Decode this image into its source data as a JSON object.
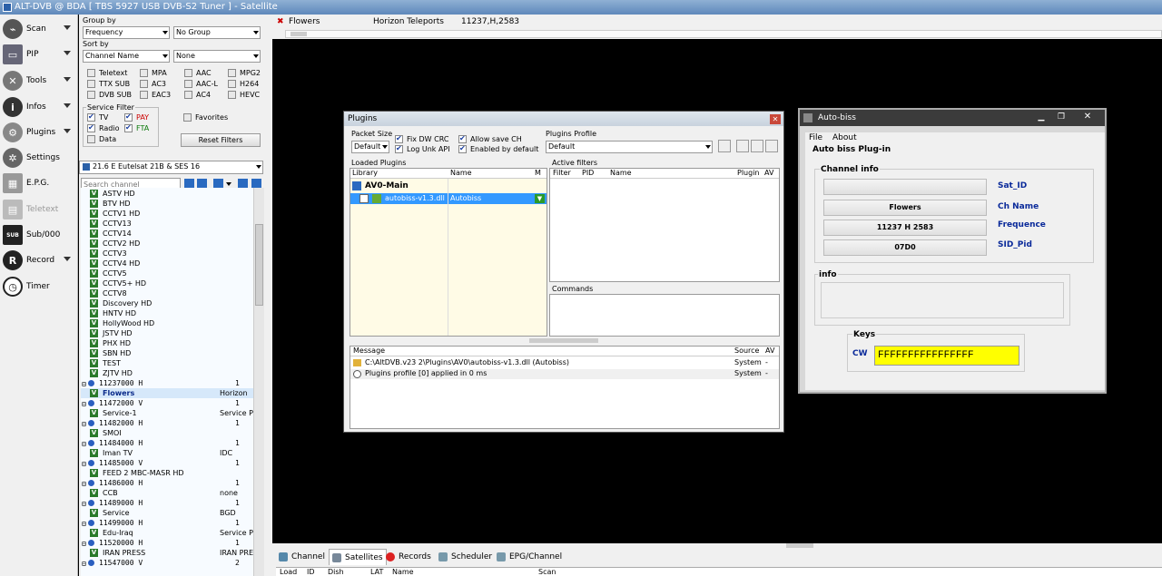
{
  "window_title": "ALT-DVB @ BDA [ TBS 5927 USB DVB-S2 Tuner ] - Satellite",
  "nav": [
    {
      "label": "Scan",
      "icon": "satellite-dish-icon",
      "arrow": true
    },
    {
      "label": "PIP",
      "icon": "pip-icon",
      "arrow": true
    },
    {
      "label": "Tools",
      "icon": "tools-icon",
      "arrow": true
    },
    {
      "label": "Infos",
      "icon": "info-icon",
      "arrow": true
    },
    {
      "label": "Plugins",
      "icon": "plugins-icon",
      "arrow": true
    },
    {
      "label": "Settings",
      "icon": "gear-icon",
      "arrow": false
    },
    {
      "label": "E.P.G.",
      "icon": "epg-icon",
      "arrow": false
    },
    {
      "label": "Teletext",
      "icon": "teletext-icon",
      "arrow": false
    },
    {
      "label": "Sub/000",
      "icon": "subtitle-icon",
      "arrow": false
    },
    {
      "label": "Record",
      "icon": "record-icon",
      "arrow": true
    },
    {
      "label": "Timer",
      "icon": "timer-icon",
      "arrow": false
    }
  ],
  "panel": {
    "group_by_label": "Group by",
    "group_by_value": "Frequency",
    "group_value": "No Group",
    "sort_by_label": "Sort by",
    "sort_by_value": "Channel Name",
    "sort_value": "None",
    "filters": [
      [
        "Teletext",
        "MPA",
        "AAC",
        "MPG2"
      ],
      [
        "TTX SUB",
        "AC3",
        "AAC-L",
        "H264"
      ],
      [
        "DVB SUB",
        "EAC3",
        "AC4",
        "HEVC"
      ]
    ],
    "service_filter_label": "Service Filter",
    "service_filters": [
      "TV",
      "PAY",
      "Radio",
      "FTA",
      "Data"
    ],
    "favorites_label": "Favorites",
    "reset_label": "Reset Filters",
    "satellite": "21.6 E Eutelsat 21B & SES 16",
    "search_placeholder": "Search channel"
  },
  "channels": [
    {
      "t": "ch",
      "name": "ASTV HD"
    },
    {
      "t": "ch",
      "name": "BTV HD"
    },
    {
      "t": "ch",
      "name": "CCTV1 HD"
    },
    {
      "t": "ch",
      "name": "CCTV13"
    },
    {
      "t": "ch",
      "name": "CCTV14"
    },
    {
      "t": "ch",
      "name": "CCTV2 HD"
    },
    {
      "t": "ch",
      "name": "CCTV3"
    },
    {
      "t": "ch",
      "name": "CCTV4 HD"
    },
    {
      "t": "ch",
      "name": "CCTV5"
    },
    {
      "t": "ch",
      "name": "CCTV5+ HD"
    },
    {
      "t": "ch",
      "name": "CCTV8"
    },
    {
      "t": "ch",
      "name": "Discovery HD"
    },
    {
      "t": "ch",
      "name": "HNTV HD"
    },
    {
      "t": "ch",
      "name": "HollyWood HD"
    },
    {
      "t": "ch",
      "name": "JSTV HD"
    },
    {
      "t": "ch",
      "name": "PHX HD"
    },
    {
      "t": "ch",
      "name": "SBN HD"
    },
    {
      "t": "ch",
      "name": "TEST"
    },
    {
      "t": "ch",
      "name": "ZJTV HD"
    },
    {
      "t": "grp",
      "name": "11237000 H",
      "c2": "1"
    },
    {
      "t": "ch",
      "name": "Flowers",
      "c2": "Horizon",
      "hl": true
    },
    {
      "t": "grp",
      "name": "11472000 V",
      "c2": "1"
    },
    {
      "t": "ch",
      "name": "Service-1",
      "c2": "Service P"
    },
    {
      "t": "grp",
      "name": "11482000 H",
      "c2": "1"
    },
    {
      "t": "ch",
      "name": "SMOI"
    },
    {
      "t": "grp",
      "name": "11484000 H",
      "c2": "1"
    },
    {
      "t": "ch",
      "name": "Iman TV",
      "c2": "IDC"
    },
    {
      "t": "grp",
      "name": "11485000 V",
      "c2": "1"
    },
    {
      "t": "ch",
      "name": "FEED 2 MBC-MASR HD"
    },
    {
      "t": "grp",
      "name": "11486000 H",
      "c2": "1"
    },
    {
      "t": "ch",
      "name": "CCB",
      "c2": "none"
    },
    {
      "t": "grp",
      "name": "11489000 H",
      "c2": "1"
    },
    {
      "t": "ch",
      "name": "Service",
      "c2": "BGD"
    },
    {
      "t": "grp",
      "name": "11499000 H",
      "c2": "1"
    },
    {
      "t": "ch",
      "name": "Edu-Iraq",
      "c2": "Service P"
    },
    {
      "t": "grp",
      "name": "11520000 H",
      "c2": "1"
    },
    {
      "t": "ch",
      "name": "IRAN PRESS",
      "c2": "IRAN PRE"
    },
    {
      "t": "grp",
      "name": "11547000 V",
      "c2": "2"
    }
  ],
  "top_strip": {
    "channel": "Flowers",
    "provider": "Horizon Teleports",
    "freq": "11237,H,2583"
  },
  "bottom_tabs": [
    "Channel",
    "Satellites",
    "Records",
    "Scheduler",
    "EPG/Channel"
  ],
  "bottom_cols": [
    "Load",
    "ID",
    "Dish",
    "LAT",
    "Name",
    "Scan"
  ],
  "plugins": {
    "title": "Plugins",
    "packet_size_label": "Packet Size",
    "packet_size": "Default",
    "checks": [
      "Fix DW CRC",
      "Log Unk API",
      "Allow save CH",
      "Enabled by default"
    ],
    "profile_label": "Plugins Profile",
    "profile_value": "Default",
    "loaded_label": "Loaded Plugins",
    "cols": [
      "Library",
      "Name",
      "M"
    ],
    "group": "AV0-Main",
    "dll": "autobiss-v1.3.dll",
    "dll_name": "Autobiss",
    "active_label": "Active filters",
    "active_cols": [
      "Filter",
      "PID",
      "Name",
      "Plugin",
      "AV"
    ],
    "commands_label": "Commands",
    "msg_cols": [
      "Message",
      "Source",
      "AV"
    ],
    "messages": [
      {
        "text": "C:\\AltDVB.v23 2\\Plugins\\AV0\\autobiss-v1.3.dll (Autobiss)",
        "src": "System",
        "av": "-"
      },
      {
        "text": "Plugins profile [0] applied in 0 ms",
        "src": "System",
        "av": "-"
      }
    ]
  },
  "autobiss": {
    "title": "Auto-biss",
    "menu": [
      "File",
      "About"
    ],
    "plugin_label": "Auto biss Plug-in",
    "channel_info": "Channel info",
    "fields": [
      {
        "value": "",
        "label": "Sat_ID"
      },
      {
        "value": "Flowers",
        "label": "Ch Name"
      },
      {
        "value": "11237 H 2583",
        "label": "Frequence"
      },
      {
        "value": "07D0",
        "label": "SID_Pid"
      }
    ],
    "info_label": "info",
    "keys_label": "Keys",
    "cw_label": "CW",
    "cw_value": "FFFFFFFFFFFFFFFF"
  }
}
